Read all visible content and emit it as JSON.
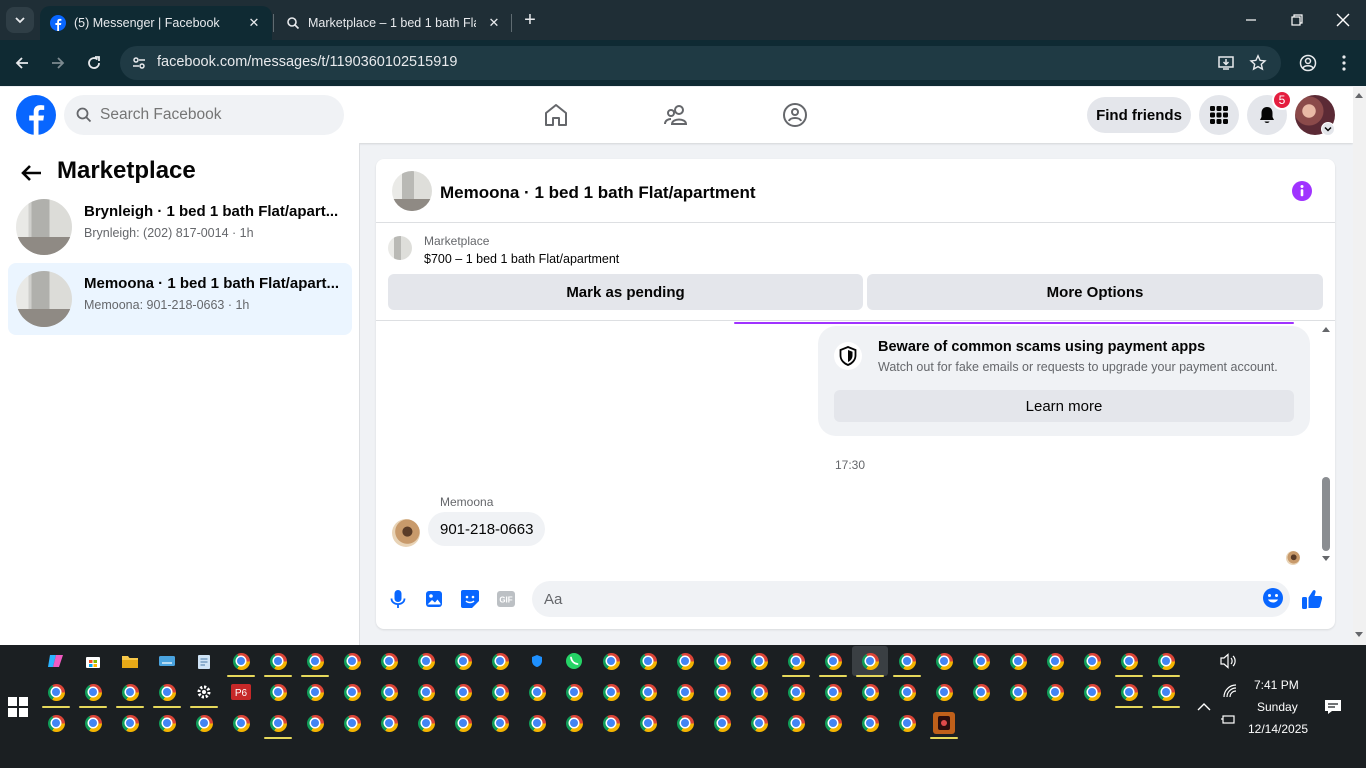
{
  "browser": {
    "tabs": [
      {
        "title": "(5) Messenger | Facebook",
        "active": true
      },
      {
        "title": "Marketplace – 1 bed 1 bath Flat/apartment",
        "active": false
      }
    ],
    "url": "facebook.com/messages/t/1190360102515919"
  },
  "fb_header": {
    "search_placeholder": "Search Facebook",
    "find_friends_label": "Find friends",
    "notification_count": "5"
  },
  "left_panel": {
    "title": "Marketplace",
    "conversations": [
      {
        "title": "Brynleigh · 1 bed 1 bath Flat/apart...",
        "subtitle": "Brynleigh: (202) 817-0014 · 1h",
        "active": false
      },
      {
        "title": "Memoona · 1 bed 1 bath Flat/apart...",
        "subtitle": "Memoona: 901-218-0663 · 1h",
        "active": true
      }
    ]
  },
  "chat": {
    "title": "Memoona · 1 bed 1 bath Flat/apartment",
    "listing": {
      "label": "Marketplace",
      "price_title": "$700 – 1 bed 1 bath Flat/apartment",
      "pending_button": "Mark as pending",
      "more_button": "More Options"
    },
    "scam_notice": {
      "title": "Beware of common scams using payment apps",
      "text": "Watch out for fake emails or requests to upgrade your payment account.",
      "button": "Learn more"
    },
    "timestamp": "17:30",
    "message": {
      "sender": "Memoona",
      "text": "901-218-0663"
    },
    "composer_placeholder": "Aa"
  },
  "taskbar": {
    "time": "7:41 PM",
    "day": "Sunday",
    "date": "12/14/2025"
  },
  "colors": {
    "fb_blue": "#0866ff",
    "messenger_purple": "#a033ff",
    "notif_red": "#e41e3f",
    "active_conv_bg": "#ebf5ff"
  }
}
